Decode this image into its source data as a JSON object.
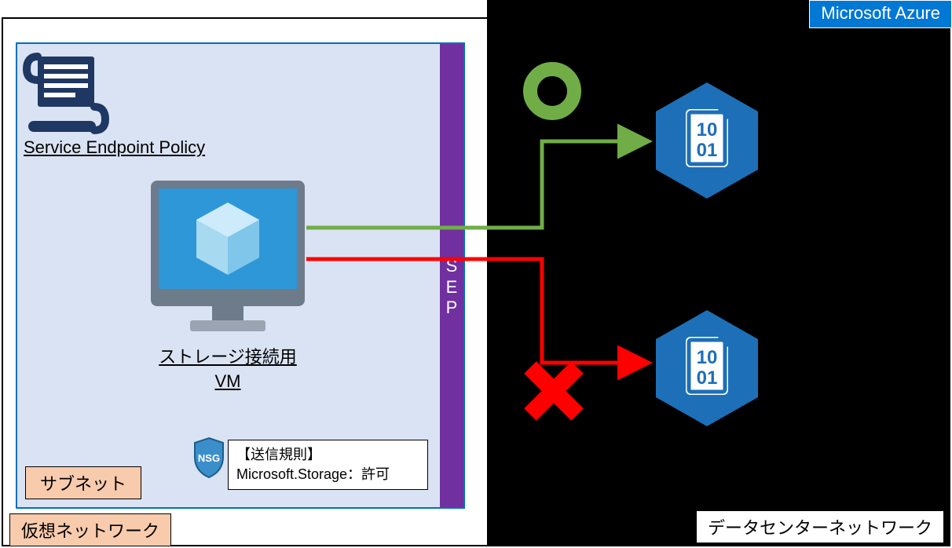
{
  "labels": {
    "azure": "Microsoft Azure",
    "datacenter_network": "データセンターネットワーク",
    "virtual_network": "仮想ネットワーク",
    "subnet": "サブネット",
    "sep": "SEP",
    "service_endpoint_policy": "Service Endpoint Policy",
    "vm_title_line1": "ストレージ接続用",
    "vm_title_line2": "VM",
    "nsg_badge": "NSG",
    "nsg_rule_header": "【送信規則】",
    "nsg_rule_body": "Microsoft.Storage：許可",
    "storage_digits_top": "10",
    "storage_digits_bottom": "01",
    "allow_symbol": "O",
    "deny_symbol": "X"
  },
  "colors": {
    "azure_blue": "#0078D4",
    "subnet_fill": "#DAE3F3",
    "subnet_border": "#0070C0",
    "peach": "#F8CBAD",
    "purple": "#7030A0",
    "allow_green": "#70AD47",
    "deny_red": "#FF0000",
    "storage_blue": "#1D6FB8",
    "azure_icon_ring": "#2E97D8",
    "azure_icon_cube": "#A7D9F0",
    "nsg_shield": "#3A8FCB"
  },
  "diagram": {
    "nodes": [
      {
        "id": "vm",
        "type": "virtual-machine",
        "label": "ストレージ接続用 VM",
        "container": "subnet"
      },
      {
        "id": "sep",
        "type": "service-endpoint-policy",
        "label": "SEP",
        "container": "subnet-edge"
      },
      {
        "id": "policy-doc",
        "type": "service-endpoint-policy-definition",
        "label": "Service Endpoint Policy",
        "container": "subnet"
      },
      {
        "id": "nsg",
        "type": "network-security-group",
        "rule": "Outbound Microsoft.Storage: Allow",
        "container": "subnet"
      },
      {
        "id": "storage-allowed",
        "type": "storage-account",
        "container": "datacenter-network"
      },
      {
        "id": "storage-denied",
        "type": "storage-account",
        "container": "datacenter-network"
      }
    ],
    "edges": [
      {
        "from": "vm",
        "to": "storage-allowed",
        "status": "allow"
      },
      {
        "from": "vm",
        "to": "storage-denied",
        "status": "deny"
      }
    ],
    "containers": [
      {
        "id": "azure",
        "label": "Microsoft Azure"
      },
      {
        "id": "datacenter-network",
        "label": "データセンターネットワーク",
        "parent": "azure"
      },
      {
        "id": "virtual-network",
        "label": "仮想ネットワーク",
        "parent": "azure"
      },
      {
        "id": "subnet",
        "label": "サブネット",
        "parent": "virtual-network"
      }
    ]
  }
}
